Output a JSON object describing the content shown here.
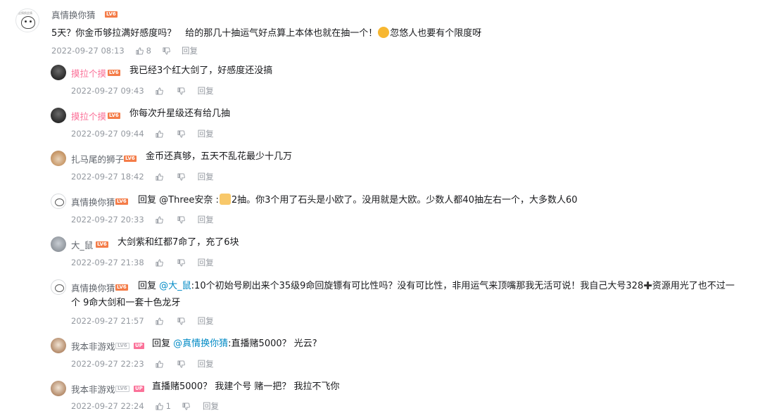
{
  "root": {
    "avatar_caption": "此情换此情",
    "user": "真情换你猜",
    "level": "LV6",
    "content_a": "5天？你金币够拉满好感度吗？　给的那几十抽运气好点算上本体也就在抽一个！",
    "content_b": "忽悠人也要有个限度呀",
    "time": "2022-09-27 08:13",
    "likes": "8",
    "reply_label": "回复"
  },
  "replies": [
    {
      "user": "摸拉个摸",
      "level": "LV6",
      "content": "我已经3个红大剑了，好感度还没搞",
      "time": "2022-09-27 09:43",
      "reply_label": "回复"
    },
    {
      "user": "摸拉个摸",
      "level": "LV6",
      "content": "你每次升星级还有给几抽",
      "time": "2022-09-27 09:44",
      "reply_label": "回复"
    },
    {
      "user": "扎马尾的狮子",
      "level": "LV6",
      "content": "金币还真够，五天不乱花最少十几万",
      "time": "2022-09-27 18:42",
      "reply_label": "回复"
    },
    {
      "user": "真情换你猜",
      "level": "LV6",
      "reply_prefix": "回复 @Three安奈 :",
      "content": "2抽。你3个用了石头是小欧了。没用就是大欧。少数人都40抽左右一个，大多数人60",
      "time": "2022-09-27 20:33",
      "reply_label": "回复"
    },
    {
      "user": "大_鼠",
      "level": "LV6",
      "content": "大剑紫和红都7命了，充了6块",
      "time": "2022-09-27 21:38",
      "reply_label": "回复"
    },
    {
      "user": "真情换你猜",
      "level": "LV6",
      "reply_word": "回复",
      "mention": "@大_鼠",
      "content_a": ":10个初始号刷出来个35级9命回旋镖有可比性吗？没有可比性，非用运气来顶嘴那我无活可说！我自己大号328",
      "content_b": "资源用光了也不过一",
      "content_line2": "个 9命大剑和一套十色龙牙",
      "time": "2022-09-27 21:57",
      "reply_label": "回复"
    },
    {
      "user": "我本非游戏",
      "level": "LV6",
      "up_badge": "UP",
      "reply_word": "回复",
      "mention": "@真情换你猜",
      "content": ":直播赌5000？ 光云?",
      "time": "2022-09-27 22:23",
      "reply_label": "回复"
    },
    {
      "user": "我本非游戏",
      "level": "LV6",
      "up_badge": "UP",
      "content": "直播赌5000？ 我建个号 赌一把？ 我拉不飞你",
      "time": "2022-09-27 22:24",
      "likes": "1",
      "reply_label": "回复"
    }
  ],
  "colors": {
    "pink_name": "#fb7299",
    "link": "#008ac5",
    "meta": "#9499a0",
    "level_badge": "#f47c48"
  }
}
